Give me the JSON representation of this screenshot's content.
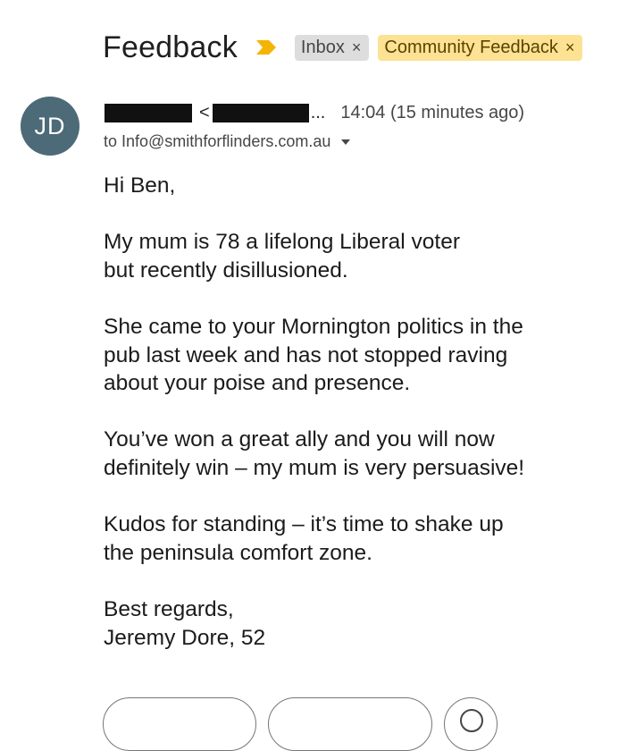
{
  "email": {
    "subject": "Feedback",
    "labels": [
      {
        "name": "Inbox",
        "remove": "×",
        "bg": "#dddddd"
      },
      {
        "name": "Community Feedback",
        "remove": "×",
        "bg": "#fde293"
      }
    ],
    "sender": {
      "avatar_initials": "JD",
      "avatar_color": "#4c6a78",
      "lt": "<",
      "ellipsis": "...",
      "time": "14:04 (15 minutes ago)",
      "to": "to Info@smithforflinders.com.au"
    },
    "body": {
      "greeting": "Hi Ben,",
      "p1_l1": "My mum is 78 a lifelong Liberal voter",
      "p1_l2": "but recently disillusioned.",
      "p2_l1": "She came to your Mornington politics in the",
      "p2_l2": "pub last week and has not stopped raving",
      "p2_l3": "about your poise and presence.",
      "p3_l1": "You’ve won a great ally and you will now",
      "p3_l2": "definitely win – my mum is very persuasive!",
      "p4_l1": "Kudos for standing – it’s time to shake up",
      "p4_l2": "the peninsula comfort zone.",
      "signoff_l1": "Best regards,",
      "signoff_l2": "Jeremy Dore, 52"
    }
  },
  "icons": {
    "importance": "importance-marker-icon",
    "dropdown": "chevron-down-icon",
    "emoji": "emoji-icon"
  },
  "colors": {
    "importance": "#f4b400",
    "community_label": "#fde293",
    "inbox_label": "#dddddd"
  }
}
